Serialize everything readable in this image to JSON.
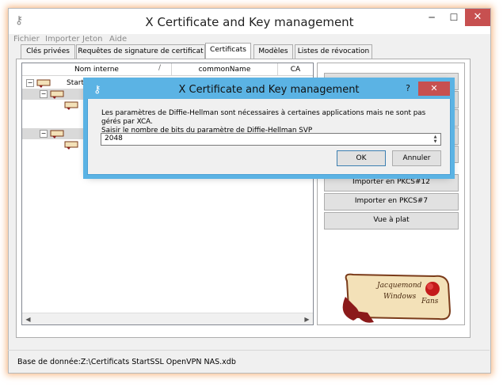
{
  "window": {
    "title": "X Certificate and Key management",
    "minimize": "─",
    "maximize": "☐",
    "close": "✕"
  },
  "menu": [
    "Fichier",
    "Importer",
    "Jeton",
    "Aide"
  ],
  "tabs": [
    {
      "label": "Clés privées",
      "active": false
    },
    {
      "label": "Requêtes de signature de certificat",
      "active": false
    },
    {
      "label": "Certificats",
      "active": true
    },
    {
      "label": "Modèles",
      "active": false
    },
    {
      "label": "Listes de révocation",
      "active": false
    }
  ],
  "tree": {
    "columns": [
      "Nom interne",
      "commonName",
      "CA"
    ],
    "sort_indicator": "/",
    "root_label": "Start",
    "expand_collapse": [
      "−",
      "−",
      "−"
    ]
  },
  "buttons": [
    "Importer en PKCS#12",
    "Importer en PKCS#7",
    "Vue à plat"
  ],
  "status": "Base de donnée:Z:\\Certificats StartSSL OpenVPN NAS.xdb",
  "dialog": {
    "title": "X Certificate and Key management",
    "help": "?",
    "close": "✕",
    "message_line1": "Les paramètres de Diffie-Hellman sont nécessaires à certaines applications mais ne sont pas gérés par XCA.",
    "message_line2": "Saisir le nombre de bits du paramètre de Diffie-Hellman SVP",
    "value": "2048",
    "ok": "OK",
    "cancel": "Annuler"
  },
  "logo_text": [
    "Jacquemond",
    "Windows",
    "Fans"
  ],
  "colors": {
    "accent_glow": "#f08228",
    "dialog_title": "#5bb3e4",
    "close_red": "#c75050"
  }
}
